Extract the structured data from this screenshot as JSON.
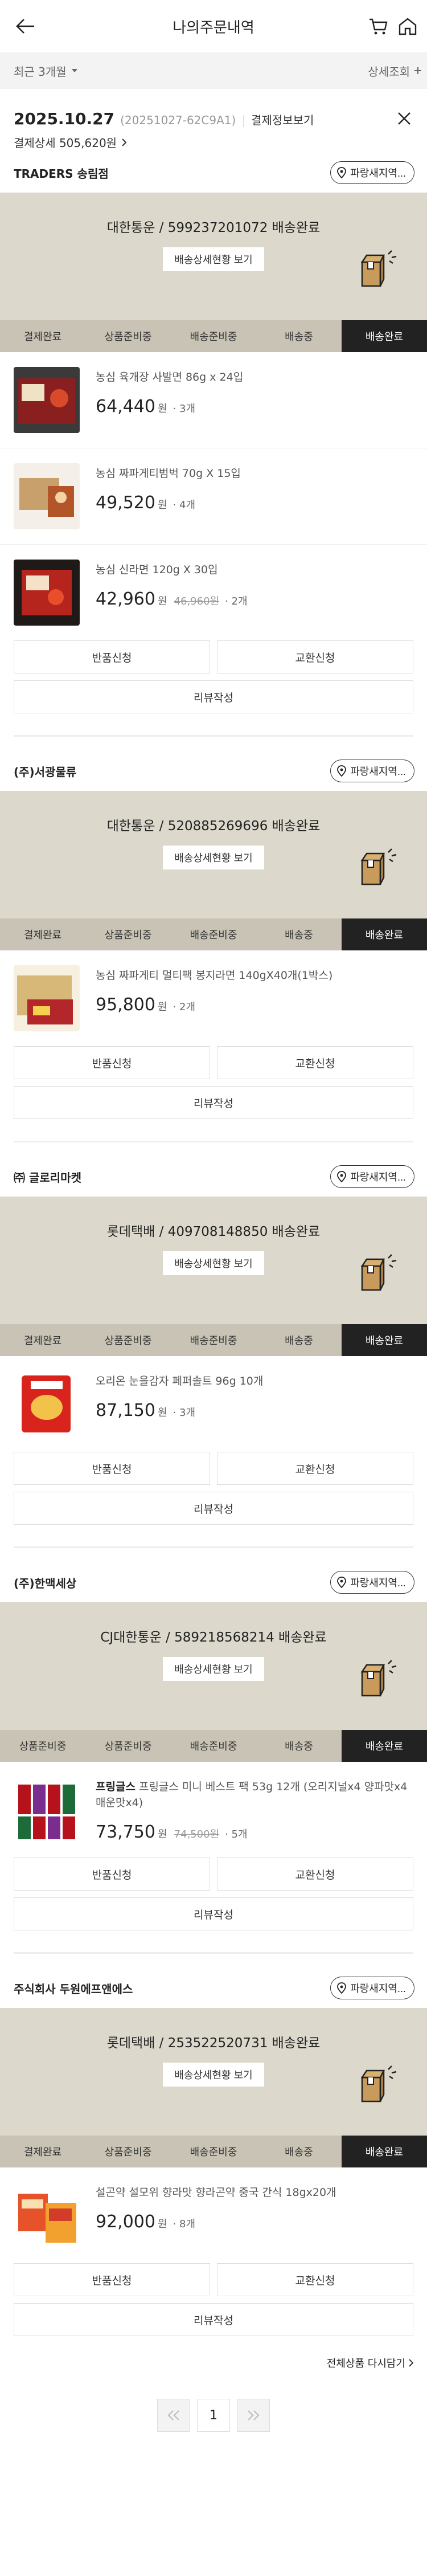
{
  "header": {
    "title": "나의주문내역",
    "back_icon": "back-arrow-icon",
    "cart_icon": "cart-icon",
    "home_icon": "home-icon"
  },
  "filter": {
    "period_label": "최근 3개월",
    "detail_label": "상세조회"
  },
  "order": {
    "date": "2025.10.27",
    "number": "(20251027-62C9A1)",
    "separator": "|",
    "pay_info_label": "결제정보보기",
    "total_label": "결제상세 505,620원"
  },
  "labels": {
    "pick_button": "파랑새지역...",
    "track_button": "배송상세현황 보기",
    "return_button": "반품신청",
    "exchange_button": "교환신청",
    "review_button": "리뷰작성",
    "won": "원",
    "reorder_all": "전체상품 다시담기",
    "page_current": "1"
  },
  "colors": {
    "banner_bg": "#dcd8cc",
    "status_bg": "#c8c3b4",
    "status_active_bg": "#222222"
  },
  "sellers": [
    {
      "name": "TRADERS 송림점",
      "shipping": "대한통운 / 599237201072 배송완료",
      "steps": [
        "결제완료",
        "상품준비중",
        "배송준비중",
        "배송중",
        "배송완료"
      ],
      "active_step": 4,
      "products": [
        {
          "name": "농심 육개장 사발면 86g x 24입",
          "price": "64,440",
          "qty": "· 3개",
          "orig": ""
        },
        {
          "name": "농심 짜파게티범벅 70g X 15입",
          "price": "49,520",
          "qty": "· 4개",
          "orig": ""
        },
        {
          "name": "농심 신라면 120g X 30입",
          "price": "42,960",
          "qty": "· 2개",
          "orig": "46,960원"
        }
      ]
    },
    {
      "name": "(주)서광물류",
      "shipping": "대한통운 / 520885269696 배송완료",
      "steps": [
        "결제완료",
        "상품준비중",
        "배송준비중",
        "배송중",
        "배송완료"
      ],
      "active_step": 4,
      "products": [
        {
          "name": "농심 짜파게티 멀티팩 봉지라면 140gX40개(1박스)",
          "price": "95,800",
          "qty": "· 2개",
          "orig": ""
        }
      ]
    },
    {
      "name": "㈜ 글로리마켓",
      "shipping": "롯데택배 / 409708148850 배송완료",
      "steps": [
        "결제완료",
        "상품준비중",
        "배송준비중",
        "배송중",
        "배송완료"
      ],
      "active_step": 4,
      "products": [
        {
          "name": "오리온 눈을감자 페퍼솔트 96g 10개",
          "price": "87,150",
          "qty": "· 3개",
          "orig": ""
        }
      ]
    },
    {
      "name": "(주)한맥세상",
      "shipping": "CJ대한통운 / 589218568214 배송완료",
      "steps": [
        "상품준비중",
        "상품준비중",
        "배송준비중",
        "배송중",
        "배송완료"
      ],
      "active_step": 4,
      "products": [
        {
          "name_bold": "프링글스",
          "name": "프링글스 미니 베스트 팩 53g 12개 (오리지널x4 양파맛x4 매운맛x4)",
          "price": "73,750",
          "qty": "· 5개",
          "orig": "74,500원"
        }
      ]
    },
    {
      "name": "주식회사 두원에프앤에스",
      "shipping": "롯데택배 / 253522520731 배송완료",
      "steps": [
        "결제완료",
        "상품준비중",
        "배송준비중",
        "배송중",
        "배송완료"
      ],
      "active_step": 4,
      "products": [
        {
          "name": "설곤약 설모위 향라맛 향라곤약 중국 간식 18gx20개",
          "price": "92,000",
          "qty": "· 8개",
          "orig": ""
        }
      ]
    }
  ]
}
